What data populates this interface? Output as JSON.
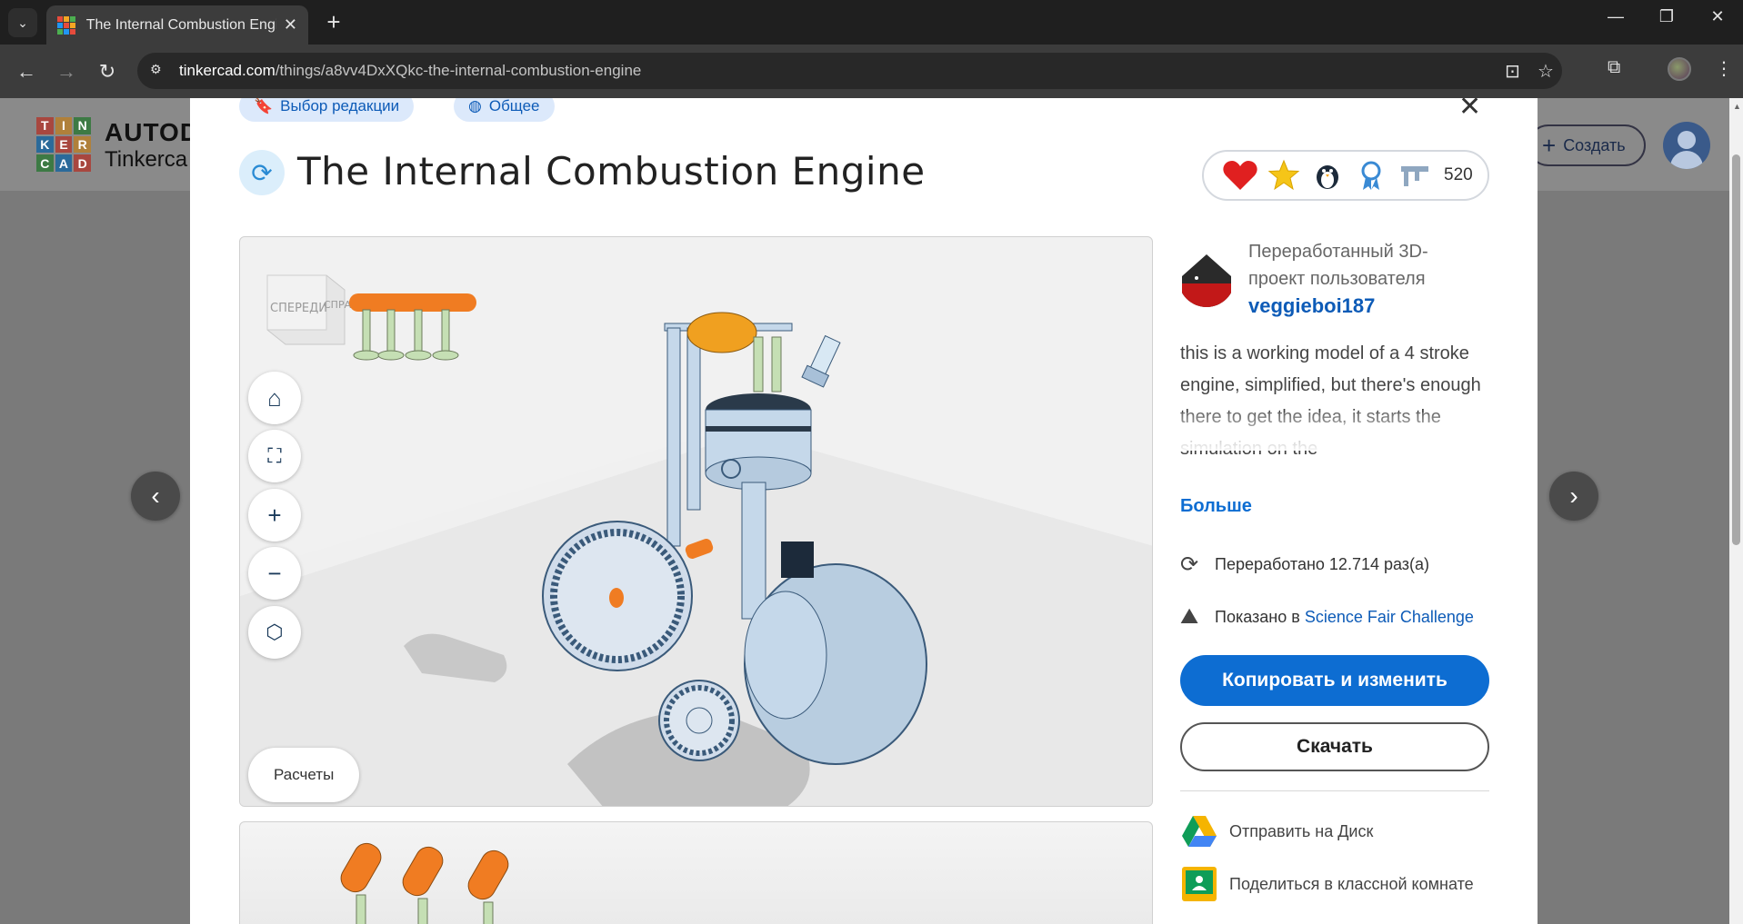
{
  "browser": {
    "tab_title": "The Internal Combustion Engine",
    "new_tab": "+",
    "url_host": "tinkercad.com",
    "url_path": "/things/a8vv4DxXQkc-the-internal-combustion-engine"
  },
  "site": {
    "logo_letters": [
      "T",
      "I",
      "N",
      "K",
      "E",
      "R",
      "C",
      "A",
      "D"
    ],
    "brand_line1": "AUTOD",
    "brand_line2": "Tinkerca",
    "create_label": "Создать"
  },
  "modal": {
    "chips": [
      "Выбор редакции",
      "Общее"
    ],
    "title": "The Internal Combustion Engine",
    "badge_count": "520",
    "viewer_cube_front": "СПЕРЕДИ",
    "viewer_cube_right": "СПРАВА",
    "calc_label": "Расчеты",
    "remix_label": "Переработанный 3D-проект пользователя",
    "author": "veggieboi187",
    "description": "this is a working model of a 4 stroke engine, simplified, but there's enough there to get the idea, it starts the simulation on the",
    "more_label": "Больше",
    "remixed_text": "Переработано 12.714 раз(а)",
    "featured_prefix": "Показано в",
    "featured_link": "Science Fair Challenge",
    "copy_edit_label": "Копировать и изменить",
    "download_label": "Скачать",
    "drive_label": "Отправить на Диск",
    "classroom_label": "Поделиться в классной комнате"
  },
  "colors": {
    "accent": "#0d6dd2",
    "link": "#0d5bb7",
    "logo_colors": [
      "#e64b3c",
      "#f5a623",
      "#4caf50",
      "#2196f3",
      "#e64b3c",
      "#f5a623",
      "#4caf50",
      "#2196f3",
      "#e64b3c"
    ]
  }
}
